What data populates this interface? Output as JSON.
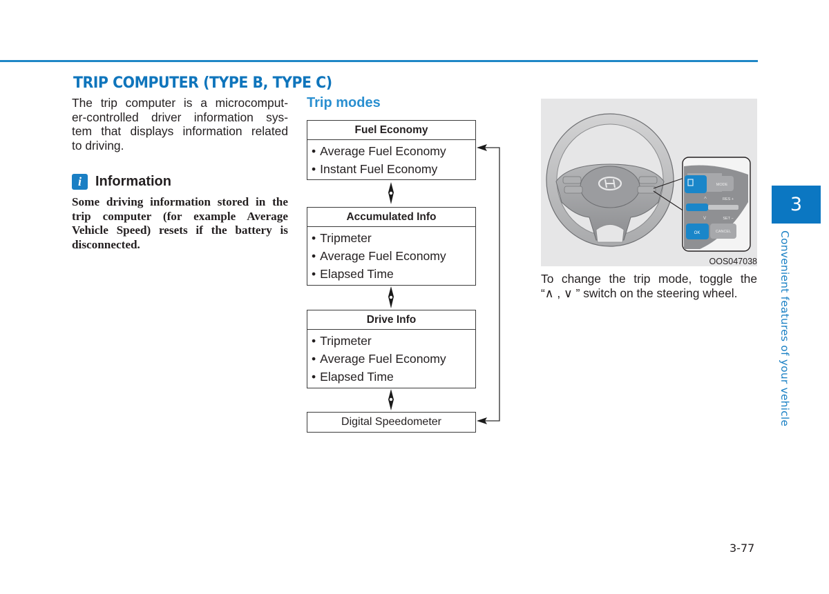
{
  "section_title": "TRIP COMPUTER (TYPE B, TYPE C)",
  "intro_lines": [
    "The trip computer is a microcomput-",
    "er-controlled driver information sys-",
    "tem that displays information related",
    "to driving."
  ],
  "information": {
    "icon": "info-icon",
    "icon_glyph": "i",
    "title": "Information",
    "body_lines": [
      "Some driving information stored in the",
      "trip computer (for example Average",
      "Vehicle Speed) resets if the battery is",
      "disconnected."
    ]
  },
  "trip_modes": {
    "heading": "Trip modes",
    "modes": [
      {
        "title": "Fuel Economy",
        "items": [
          "Average Fuel Economy",
          "Instant Fuel Economy"
        ]
      },
      {
        "title": "Accumulated Info",
        "items": [
          "Tripmeter",
          "Average Fuel Economy",
          "Elapsed Time"
        ]
      },
      {
        "title": "Drive Info",
        "items": [
          "Tripmeter",
          "Average Fuel Economy",
          "Elapsed Time"
        ]
      },
      {
        "title": "Digital Speedometer",
        "items": []
      }
    ]
  },
  "figure": {
    "code": "OOS047038",
    "buttons": {
      "ok": "OK",
      "cancel": "CANCEL",
      "res": "RES +",
      "set": "SET −",
      "mode": "MODE"
    },
    "caption_lines": [
      "To change the trip mode, toggle the",
      "“∧ , ∨ ” switch on the steering wheel."
    ]
  },
  "chapter": {
    "number": "3",
    "title": "Convenient features of your vehicle"
  },
  "page_number": "3-77",
  "colors": {
    "accent": "#0f75bc",
    "chapter_tab": "#0b77c2",
    "rule": "#1f86c6",
    "figure_bg": "#e6e6e7",
    "button_blue": "#1a86c9"
  }
}
